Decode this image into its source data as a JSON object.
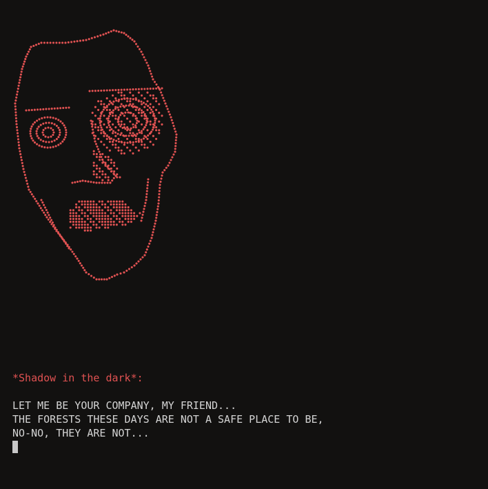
{
  "portrait": {
    "icon": "ascii-face-portrait-icon",
    "color": "#e05252"
  },
  "speaker": {
    "name": "*Shadow in the dark*:",
    "color": "#e05252"
  },
  "dialogue": {
    "lines": [
      "LET ME BE YOUR COMPANY, MY FRIEND...",
      "THE FORESTS THESE DAYS ARE NOT A SAFE PLACE TO BE,",
      "NO-NO, THEY ARE NOT..."
    ],
    "color": "#d4d4d4"
  },
  "cursor": {
    "color": "#c8c8c8"
  }
}
